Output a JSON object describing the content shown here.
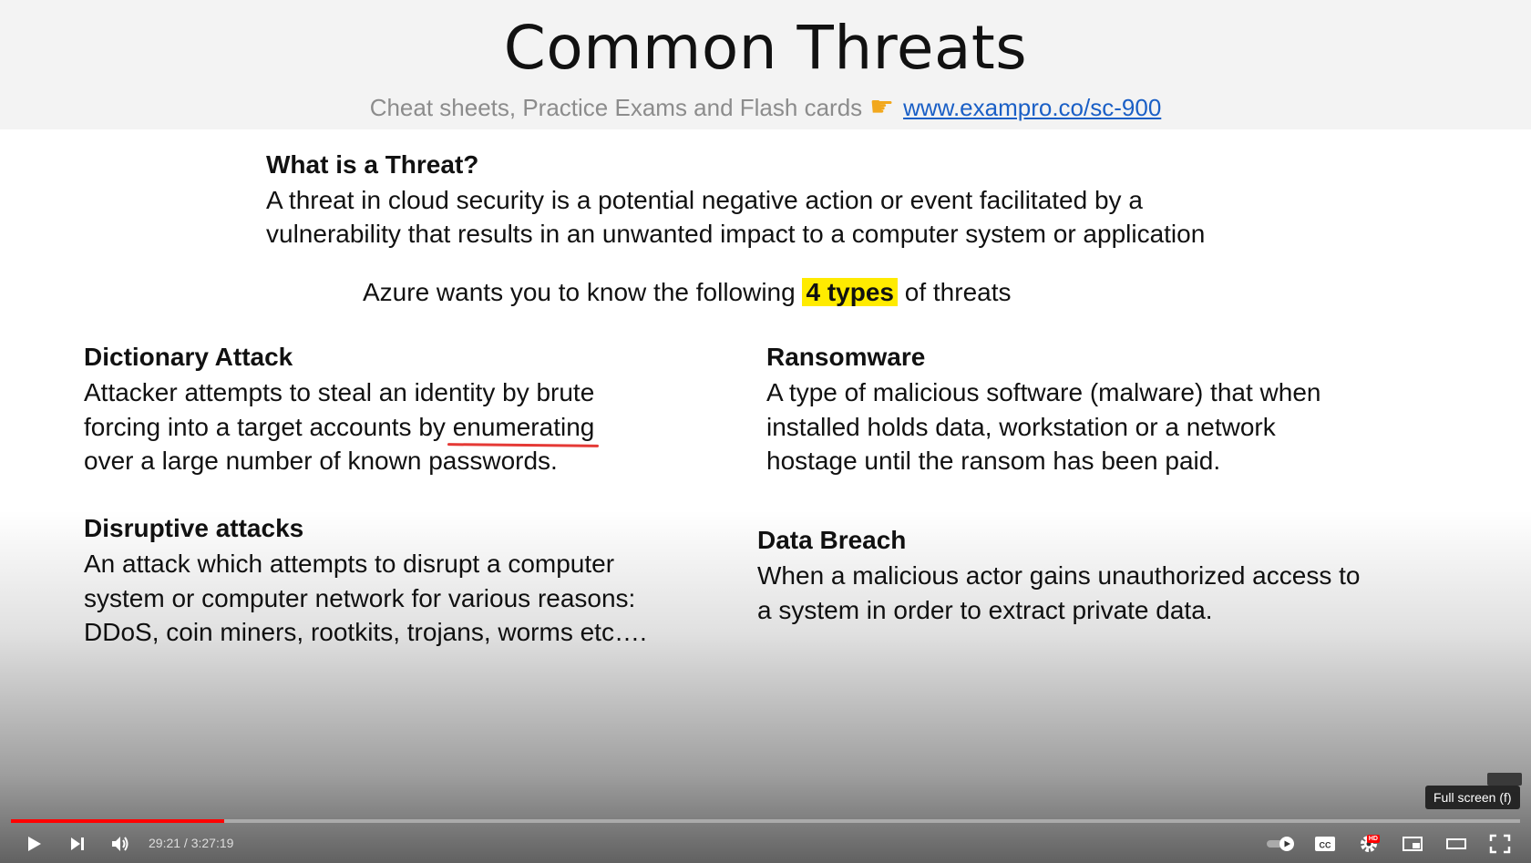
{
  "slide": {
    "title": "Common Threats",
    "subtitle_text": "Cheat sheets, Practice Exams and Flash cards",
    "subtitle_link": "www.exampro.co/sc-900",
    "question_heading": "What is a Threat?",
    "definition_line1": "A threat in cloud security is a potential negative action or event facilitated by a",
    "definition_line2": "vulnerability that results in an unwanted impact to a computer system or application",
    "types_pre": "Azure wants you to know the following ",
    "types_highlight": "4 types",
    "types_post": " of threats",
    "sections": {
      "dictionary": {
        "heading": "Dictionary Attack",
        "line1": "Attacker attempts to steal an identity by brute",
        "line2_pre": "forcing into a target accounts by ",
        "line2_underlined": "enumerating",
        "line3": "over a large number of known passwords."
      },
      "ransomware": {
        "heading": "Ransomware",
        "line1": "A type of malicious software (malware) that when",
        "line2": "installed holds data, workstation or a network",
        "line3": "hostage until the ransom has been paid."
      },
      "disruptive": {
        "heading": "Disruptive attacks",
        "line1": "An attack which attempts to disrupt a computer",
        "line2": "system or computer network for various reasons:",
        "line3": "DDoS, coin miners, rootkits, trojans, worms etc…."
      },
      "breach": {
        "heading": "Data Breach",
        "line1": "When a malicious actor gains unauthorized access to",
        "line2": "a system in order to extract private data."
      }
    }
  },
  "player": {
    "tooltip": "Full screen (f)",
    "time_display": "29:21 / 3:27:19",
    "progress_fraction": 0.1414,
    "buffer_fraction": 0.1415,
    "hd_badge": "HD",
    "accent_color": "#ff0000",
    "icons": [
      "play-icon",
      "next-icon",
      "volume-icon",
      "autoplay-toggle-icon",
      "subtitles-icon",
      "settings-icon",
      "miniplayer-icon",
      "theater-mode-icon",
      "fullscreen-icon"
    ]
  }
}
